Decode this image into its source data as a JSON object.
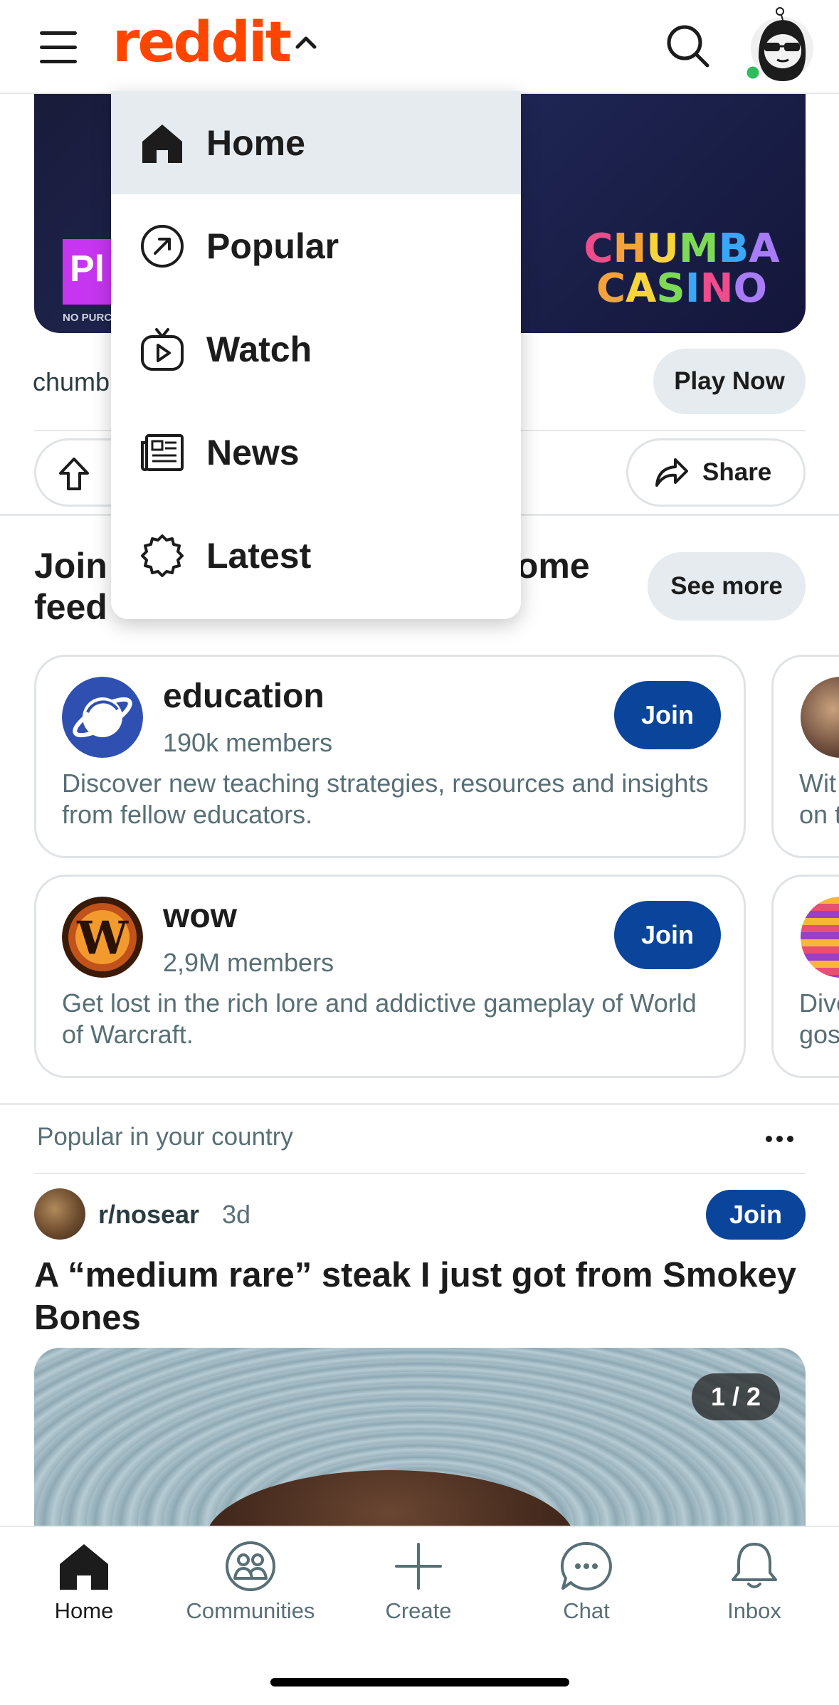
{
  "header": {
    "logo_text": "reddit",
    "brand_color": "#ff4500"
  },
  "ad": {
    "brand_line1": "CHUMBA",
    "brand_line2": "CASINO",
    "badge_text": "Pl",
    "fine_print": "NO PURC",
    "source": "chumb",
    "cta_label": "Play Now",
    "share_label": "Share"
  },
  "dropdown": {
    "items": [
      {
        "label": "Home",
        "icon": "home-icon",
        "active": true
      },
      {
        "label": "Popular",
        "icon": "trending-arrow-icon"
      },
      {
        "label": "Watch",
        "icon": "watch-tv-icon"
      },
      {
        "label": "News",
        "icon": "newspaper-icon"
      },
      {
        "label": "Latest",
        "icon": "badge-starburst-icon"
      }
    ]
  },
  "join_section": {
    "title": "Join communities for your Home feed",
    "see_more_label": "See more",
    "communities": [
      {
        "name": "education",
        "members": "190k members",
        "description": "Discover new teaching strategies, resources and insights from fellow educators.",
        "join_label": "Join"
      },
      {
        "name": "wow",
        "members": "2,9M members",
        "description": "Get lost in the rich lore and addictive gameplay of World of Warcraft.",
        "join_label": "Join"
      }
    ],
    "peek_cards": [
      {
        "text_line1": "Wit",
        "text_line2": "on t"
      },
      {
        "text_line1": "Dive",
        "text_line2": "gos"
      }
    ]
  },
  "feed": {
    "section_label": "Popular in your country",
    "post": {
      "subreddit": "r/nosear",
      "age": "3d",
      "join_label": "Join",
      "title": "A “medium rare” steak I just got from Smokey Bones",
      "image_counter": "1 / 2"
    }
  },
  "bottom_nav": {
    "items": [
      {
        "label": "Home",
        "icon": "home-icon",
        "active": true
      },
      {
        "label": "Communities",
        "icon": "communities-icon"
      },
      {
        "label": "Create",
        "icon": "plus-icon"
      },
      {
        "label": "Chat",
        "icon": "chat-bubble-icon"
      },
      {
        "label": "Inbox",
        "icon": "bell-icon"
      }
    ]
  },
  "colors": {
    "join_button": "#0a449b",
    "pill_background": "#e5ebee",
    "muted_text": "#576f76"
  }
}
